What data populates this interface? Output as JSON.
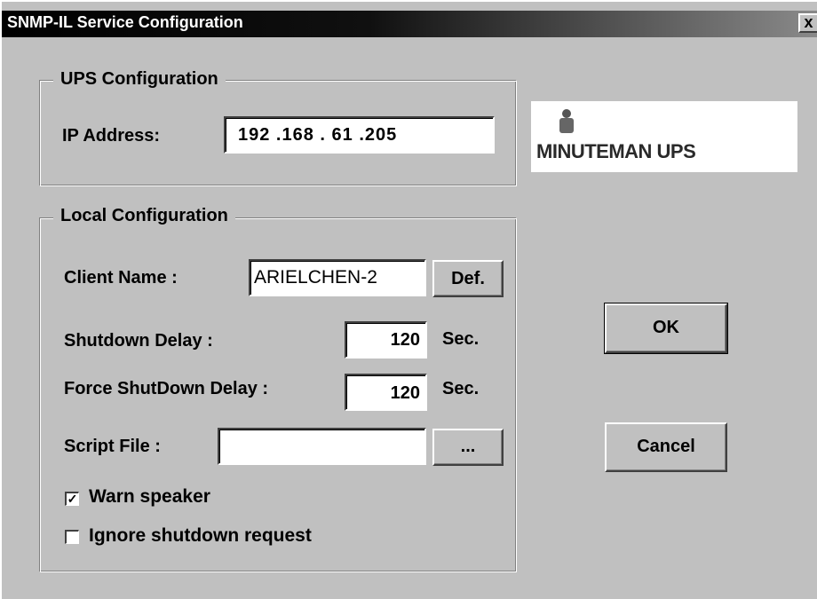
{
  "window": {
    "title": "SNMP-IL Service Configuration",
    "close_symbol": "x"
  },
  "ups_config": {
    "legend": "UPS Configuration",
    "ip_label": "IP Address:",
    "ip_value": "192 .168 . 61  .205"
  },
  "logo": {
    "icon": "minuteman-figure-icon",
    "text": "MINUTEMAN UPS"
  },
  "local_config": {
    "legend": "Local Configuration",
    "client_name_label": "Client Name :",
    "client_name_value": "ARIELCHEN-2",
    "def_button": "Def.",
    "shutdown_delay_label": "Shutdown Delay :",
    "shutdown_delay_value": "120",
    "shutdown_delay_unit": "Sec.",
    "force_shutdown_label": "Force ShutDown Delay :",
    "force_shutdown_value": "120",
    "force_shutdown_unit": "Sec.",
    "script_file_label": "Script File :",
    "script_file_value": "",
    "browse_button": "...",
    "warn_speaker": {
      "label": "Warn speaker",
      "checked": true,
      "mark": "✓"
    },
    "ignore_shutdown": {
      "label": "Ignore shutdown request",
      "checked": false,
      "mark": ""
    }
  },
  "buttons": {
    "ok": "OK",
    "cancel": "Cancel"
  }
}
